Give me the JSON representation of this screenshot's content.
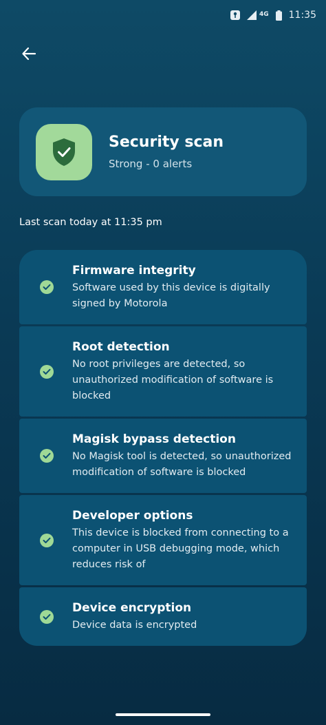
{
  "status_bar": {
    "network": "4G",
    "time": "11:35"
  },
  "header": {
    "back_icon": "arrow-left-icon"
  },
  "scan_card": {
    "icon": "shield-check-icon",
    "title": "Security scan",
    "subtitle": "Strong - 0 alerts",
    "tile_color": "#a2d99a",
    "shield_color": "#2c6c3c"
  },
  "last_scan": "Last scan today at 11:35 pm",
  "checks": [
    {
      "title": "Firmware integrity",
      "description": "Software used by this device is digitally signed by Motorola",
      "status_icon": "check-circle-icon"
    },
    {
      "title": "Root detection",
      "description": "No root privileges are detected, so unauthorized modification of software is blocked",
      "status_icon": "check-circle-icon"
    },
    {
      "title": "Magisk bypass detection",
      "description": "No Magisk tool is detected, so unauthorized modification of software is blocked",
      "status_icon": "check-circle-icon"
    },
    {
      "title": "Developer options",
      "description": "This device is blocked from connecting to a computer in USB debugging mode, which reduces risk of",
      "status_icon": "check-circle-icon"
    },
    {
      "title": "Device encryption",
      "description": "Device data is encrypted",
      "status_icon": "check-circle-icon"
    }
  ],
  "colors": {
    "accent_green": "#9fd996",
    "card_background": "#0c5273"
  }
}
